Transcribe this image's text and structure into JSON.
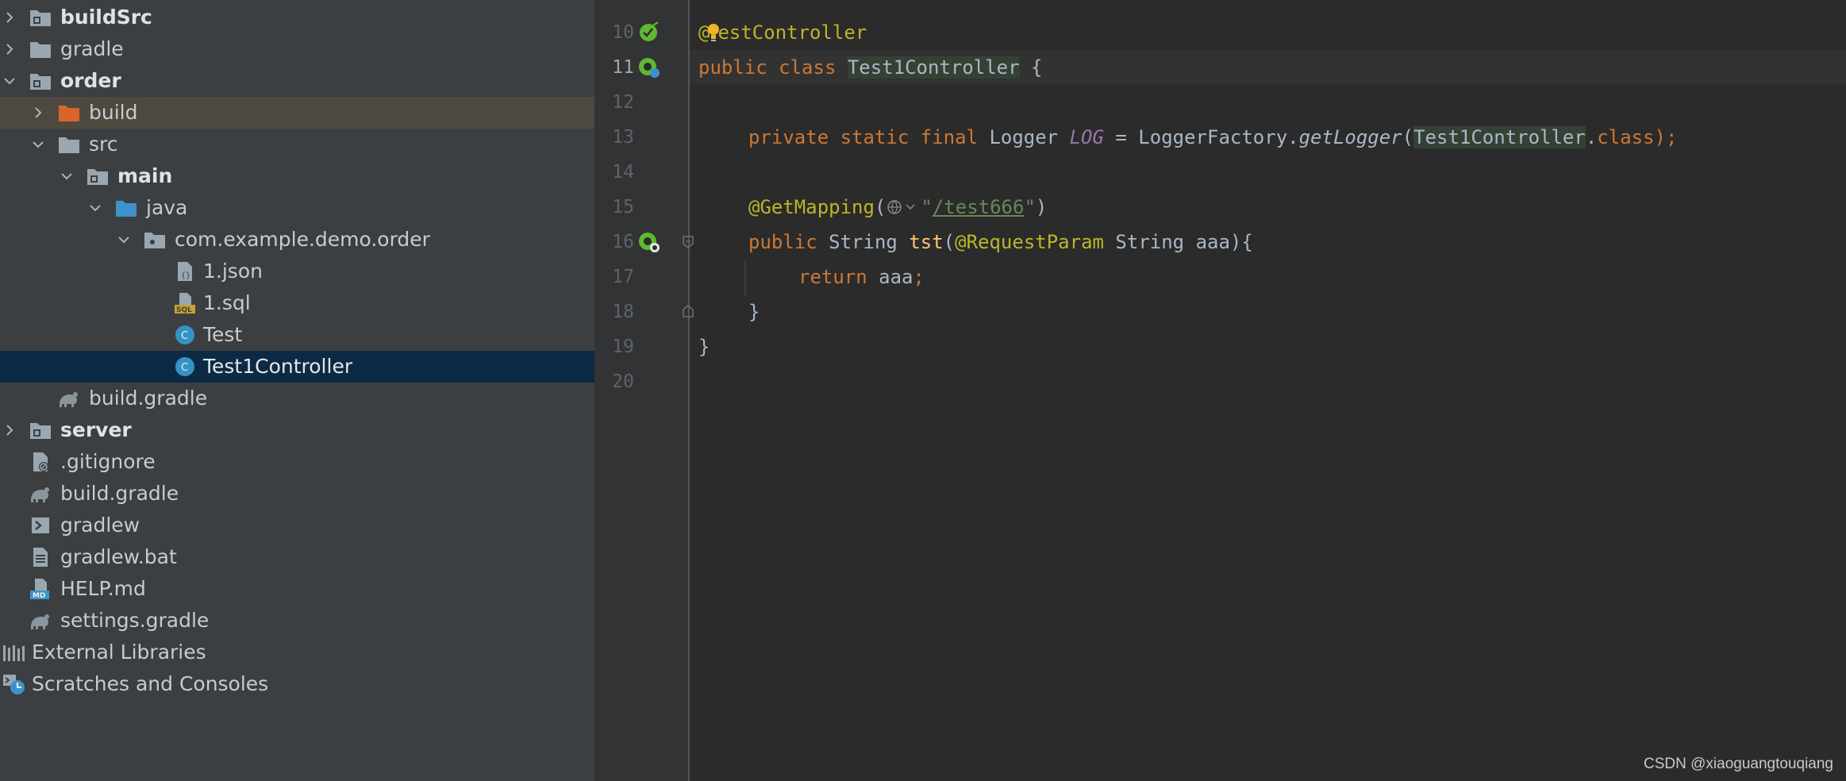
{
  "tree": {
    "items": [
      {
        "label": "buildSrc",
        "icon": "module-folder-icon"
      },
      {
        "label": "gradle",
        "icon": "folder-icon"
      },
      {
        "label": "order",
        "icon": "module-folder-icon"
      },
      {
        "label": "build",
        "icon": "excluded-folder-icon"
      },
      {
        "label": "src",
        "icon": "folder-icon"
      },
      {
        "label": "main",
        "icon": "module-folder-icon"
      },
      {
        "label": "java",
        "icon": "source-folder-icon"
      },
      {
        "label": "com.example.demo.order",
        "icon": "package-icon"
      },
      {
        "label": "1.json",
        "icon": "json-file-icon"
      },
      {
        "label": "1.sql",
        "icon": "sql-file-icon"
      },
      {
        "label": "Test",
        "icon": "class-icon"
      },
      {
        "label": "Test1Controller",
        "icon": "class-icon"
      },
      {
        "label": "build.gradle",
        "icon": "gradle-icon"
      },
      {
        "label": "server",
        "icon": "module-folder-icon"
      },
      {
        "label": ".gitignore",
        "icon": "gitignore-file-icon"
      },
      {
        "label": "build.gradle",
        "icon": "gradle-icon"
      },
      {
        "label": "gradlew",
        "icon": "shell-script-icon"
      },
      {
        "label": "gradlew.bat",
        "icon": "text-file-icon"
      },
      {
        "label": "HELP.md",
        "icon": "markdown-file-icon"
      },
      {
        "label": "settings.gradle",
        "icon": "gradle-icon"
      },
      {
        "label": "External Libraries",
        "icon": "libraries-icon"
      },
      {
        "label": "Scratches and Consoles",
        "icon": "scratches-icon"
      }
    ]
  },
  "editor": {
    "line_numbers": [
      "10",
      "11",
      "12",
      "13",
      "14",
      "15",
      "16",
      "17",
      "18",
      "19",
      "20"
    ],
    "code": {
      "l10_at": "@",
      "l10_name": "estController",
      "l11_kw": "public class ",
      "l11_name": "Test1Controller",
      "l11_rest": " {",
      "l13_kw": "private static final ",
      "l13_type": "Logger ",
      "l13_field": "LOG",
      "l13_eq": " = LoggerFactory.",
      "l13_method": "getLogger",
      "l13_paren": "(",
      "l13_cls": "Test1Controller",
      "l13_dot": ".",
      "l13_class": "class",
      "l13_end": ");",
      "l15_ann": "@GetMapping",
      "l15_open": "(",
      "l15_q1": "\"",
      "l15_path": "/test666",
      "l15_q2": "\"",
      "l15_close": ")",
      "l16_kw": "public ",
      "l16_type": "String ",
      "l16_fn": "tst",
      "l16_p": "(",
      "l16_ann": "@RequestParam",
      "l16_rest": " String aaa){",
      "l17_kw": "return ",
      "l17_val": "aaa",
      "l17_semi": ";",
      "l18": "}",
      "l19": "}"
    }
  },
  "watermark": "CSDN @xiaoguangtouqiang"
}
